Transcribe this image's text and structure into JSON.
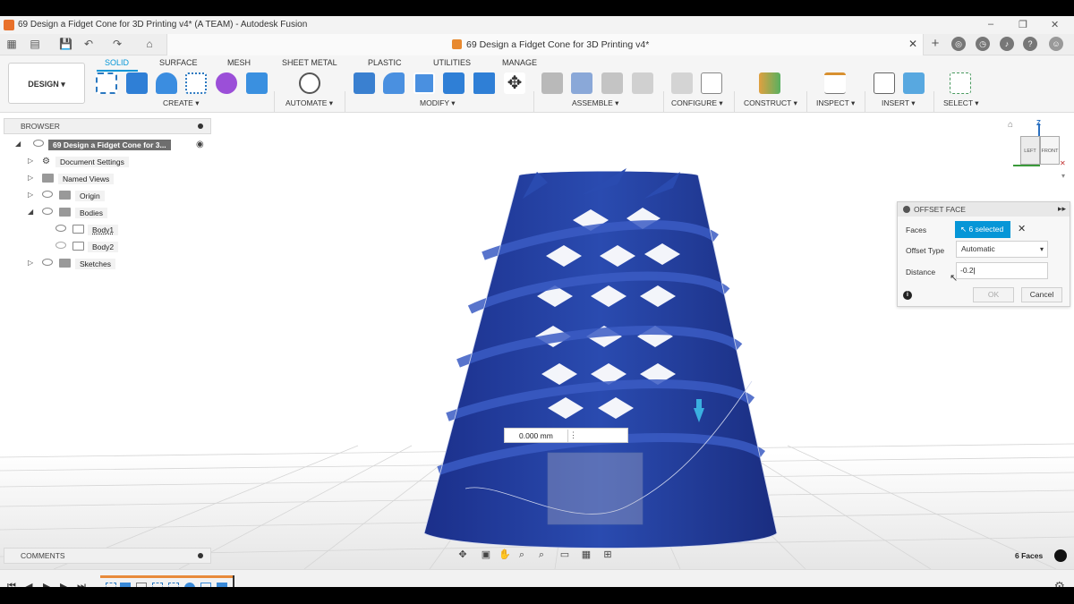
{
  "window": {
    "title": "69 Design a Fidget Cone for 3D Printing v4* (A TEAM) - Autodesk Fusion",
    "doc_tab_title": "69 Design a Fidget Cone for 3D Printing v4*"
  },
  "workspace": {
    "label": "DESIGN ▾"
  },
  "tabs": [
    "SOLID",
    "SURFACE",
    "MESH",
    "SHEET METAL",
    "PLASTIC",
    "UTILITIES",
    "MANAGE"
  ],
  "groups": {
    "create": "CREATE ▾",
    "automate": "AUTOMATE ▾",
    "modify": "MODIFY ▾",
    "assemble": "ASSEMBLE ▾",
    "configure": "CONFIGURE ▾",
    "construct": "CONSTRUCT ▾",
    "inspect": "INSPECT ▾",
    "insert": "INSERT ▾",
    "select": "SELECT ▾"
  },
  "browser": {
    "title": "BROWSER",
    "root": "69 Design a Fidget Cone for 3...",
    "items": [
      "Document Settings",
      "Named Views",
      "Origin",
      "Bodies",
      "Body1",
      "Body2",
      "Sketches"
    ]
  },
  "viewcube": {
    "axis": "Z",
    "left": "LEFT",
    "front": "FRONT"
  },
  "offset_face": {
    "title": "OFFSET FACE",
    "faces_label": "Faces",
    "faces_value": "6 selected",
    "offset_type_label": "Offset Type",
    "offset_type_value": "Automatic",
    "distance_label": "Distance",
    "distance_value": "-0.2",
    "ok": "OK",
    "cancel": "Cancel"
  },
  "dimension": {
    "value": "0.000 mm"
  },
  "comments": {
    "title": "COMMENTS"
  },
  "status": {
    "selection": "6 Faces"
  },
  "colors": {
    "accent": "#0696d7",
    "body_blue": "#1f3f9c"
  }
}
